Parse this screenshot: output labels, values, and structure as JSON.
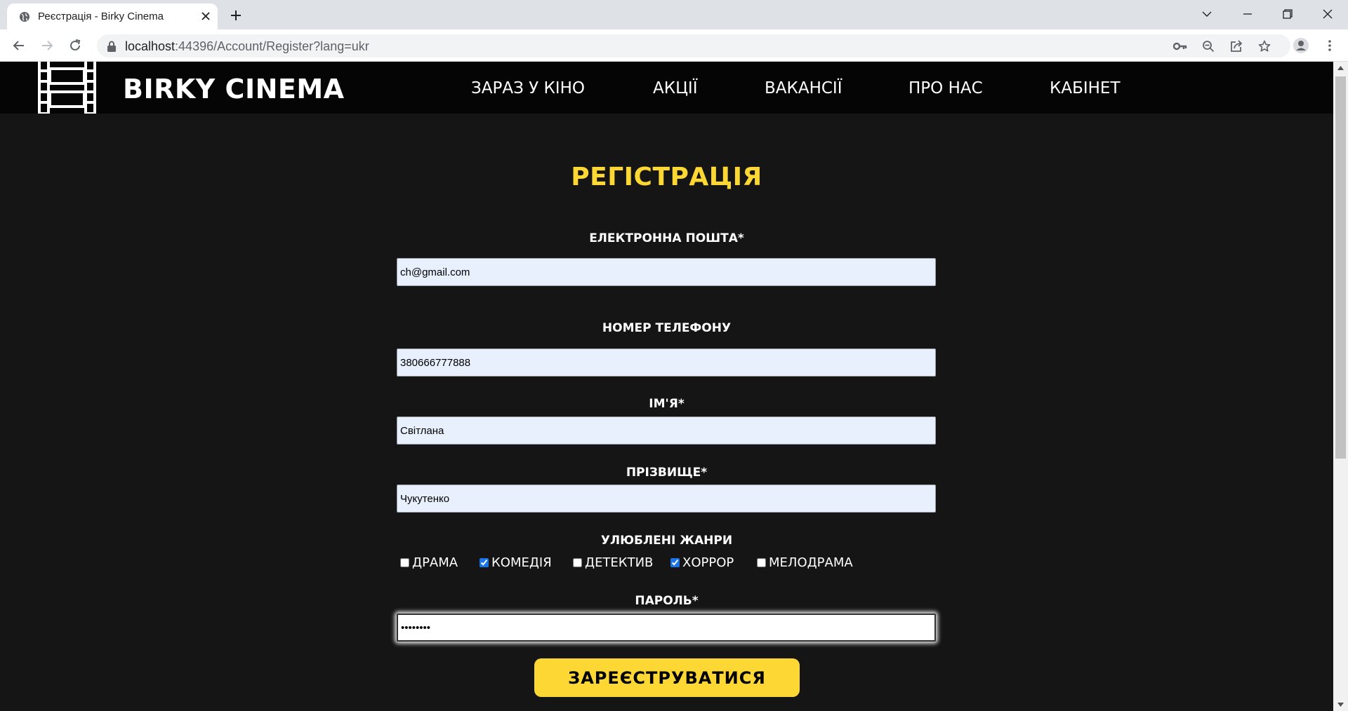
{
  "browser": {
    "tab_title": "Реєстрація - Birky Cinema",
    "url_host": "localhost",
    "url_rest": ":44396/Account/Register?lang=ukr"
  },
  "site": {
    "brand": "BIRKY CINEMA",
    "nav": [
      "ЗАРАЗ У КІНО",
      "АКЦІЇ",
      "ВАКАНСІЇ",
      "ПРО НАС",
      "КАБІНЕТ"
    ]
  },
  "form": {
    "title": "РЕГІСТРАЦІЯ",
    "email_label": "ЕЛЕКТРОННА ПОШТА*",
    "email_value": "ch@gmail.com",
    "phone_label": "НОМЕР ТЕЛЕФОНУ",
    "phone_value": "380666777888",
    "name_label": "ІМ'Я*",
    "name_value": "Світлана",
    "surname_label": "ПРІЗВИЩЕ*",
    "surname_value": "Чукутенко",
    "genres_label": "УЛЮБЛЕНІ ЖАНРИ",
    "genres": [
      {
        "label": "ДРАМА",
        "checked": false
      },
      {
        "label": "КОМЕДІЯ",
        "checked": true
      },
      {
        "label": "ДЕТЕКТИВ",
        "checked": false
      },
      {
        "label": "ХОРРОР",
        "checked": true
      },
      {
        "label": "МЕЛОДРАМА",
        "checked": false
      }
    ],
    "password_label": "ПАРОЛЬ*",
    "password_value": "12345678",
    "submit_label": "ЗАРЕЄСТРУВАТИСЯ"
  },
  "colors": {
    "accent": "#fdd835",
    "page_bg": "#151515",
    "header_bg": "#050505",
    "autofill_bg": "#e8f0fe"
  },
  "icons": [
    "globe-icon",
    "close-icon",
    "plus-icon",
    "chevron-down-icon",
    "minimize-icon",
    "restore-icon",
    "window-close-icon",
    "back-arrow-icon",
    "forward-arrow-icon",
    "reload-icon",
    "lock-icon",
    "key-icon",
    "zoom-out-icon",
    "share-icon",
    "star-icon",
    "profile-icon",
    "more-vert-icon",
    "film-strip-icon"
  ]
}
